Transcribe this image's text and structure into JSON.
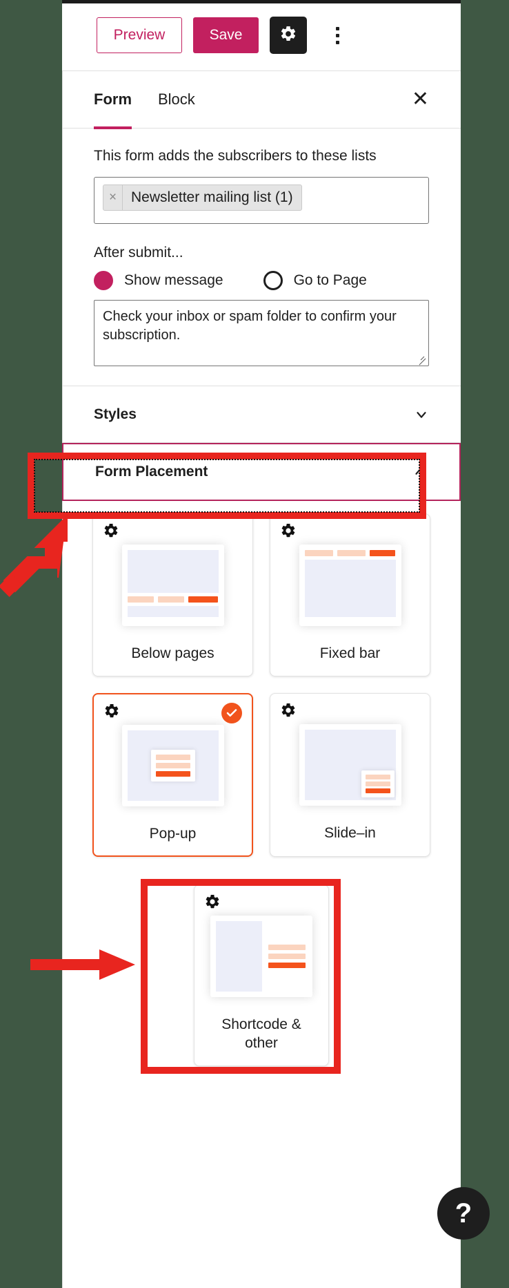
{
  "colors": {
    "brand_pink": "#c2205f",
    "accent_orange": "#f1531c",
    "annotation_red": "#e8251f",
    "panel_bg": "#ffffff",
    "page_bg": "#3f5844",
    "thumb_blue": "#eceef9",
    "thumb_peach": "#fbd4bf"
  },
  "toolbar": {
    "preview_label": "Preview",
    "save_label": "Save",
    "settings_icon": "gear-icon",
    "more_icon": "kebab-menu-icon"
  },
  "tabs": {
    "items": [
      {
        "label": "Form",
        "active": true
      },
      {
        "label": "Block",
        "active": false
      }
    ],
    "close_icon": "close-icon",
    "close_glyph": "✕"
  },
  "form_section": {
    "lists_label": "This form adds the subscribers to these lists",
    "selected_list": {
      "remove_glyph": "×",
      "label": "Newsletter mailing list (1)"
    },
    "after_submit_label": "After submit...",
    "options": [
      {
        "label": "Show message",
        "selected": true
      },
      {
        "label": "Go to Page",
        "selected": false
      }
    ],
    "message_value": "Check your inbox or spam folder to confirm your subscription."
  },
  "accordions": [
    {
      "label": "Styles",
      "expanded": false,
      "chevron": "chevron-down-icon"
    },
    {
      "label": "Form Placement",
      "expanded": true,
      "chevron": "chevron-up-icon"
    }
  ],
  "placement": {
    "cards": [
      {
        "label": "Below pages",
        "selected": false,
        "gear_icon": "gear-icon",
        "thumb": "below-pages-thumbnail"
      },
      {
        "label": "Fixed bar",
        "selected": false,
        "gear_icon": "gear-icon",
        "thumb": "fixed-bar-thumbnail"
      },
      {
        "label": "Pop-up",
        "selected": true,
        "gear_icon": "gear-icon",
        "check_icon": "check-circle-icon",
        "thumb": "pop-up-thumbnail"
      },
      {
        "label": "Slide–in",
        "selected": false,
        "gear_icon": "gear-icon",
        "thumb": "slide-in-thumbnail"
      }
    ],
    "shortcode_card": {
      "label": "Shortcode & other",
      "selected": false,
      "gear_icon": "gear-icon",
      "thumb": "shortcode-thumbnail"
    }
  },
  "help": {
    "label": "?",
    "icon": "help-icon"
  },
  "annotations": [
    {
      "name": "form-placement-highlight",
      "shape": "rectangle"
    },
    {
      "name": "shortcode-card-highlight",
      "shape": "rectangle"
    },
    {
      "name": "arrow-to-form-placement",
      "shape": "arrow"
    },
    {
      "name": "arrow-to-shortcode-card",
      "shape": "arrow"
    }
  ]
}
